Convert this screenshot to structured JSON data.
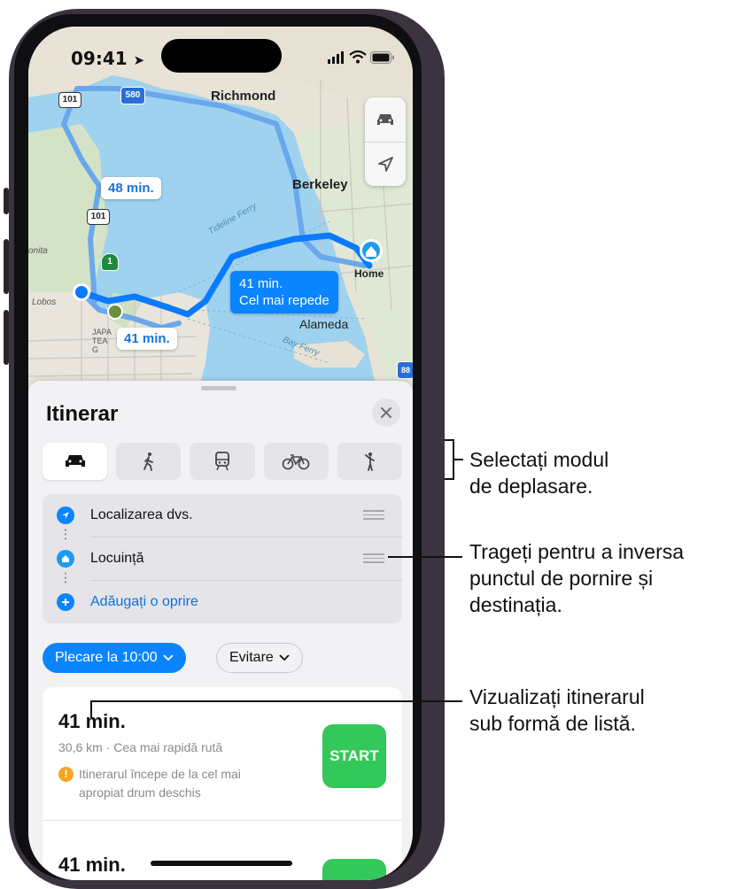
{
  "status_bar": {
    "time": "09:41"
  },
  "map": {
    "labels": {
      "richmond": "Richmond",
      "berkeley": "Berkeley",
      "alameda": "Alameda",
      "home": "Home",
      "lobos": "Lobos",
      "onita": "onita",
      "japan_tea": "JAPA TEA G"
    },
    "highway_shields": {
      "us101_top": "101",
      "us101_mid": "101",
      "i580": "580",
      "ca1": "1",
      "i880": "88"
    },
    "route_callouts": {
      "route1": "48 min.",
      "route2_time": "41 min.",
      "route2_label": "Cel mai repede",
      "route3": "41 min."
    },
    "ferry_labels": {
      "tideline": "Tideline Ferry",
      "bay": "Bay Ferry"
    }
  },
  "sheet": {
    "title": "Itinerar",
    "transport_modes": [
      "car-icon",
      "walk-icon",
      "transit-icon",
      "bicycle-icon",
      "rideshare-icon"
    ],
    "stops": [
      {
        "label": "Localizarea dvs."
      },
      {
        "label": "Locuință"
      },
      {
        "label": "Adăugați o oprire"
      }
    ],
    "depart_button": "Plecare la 10:00",
    "avoid_button": "Evitare",
    "routes": [
      {
        "time": "41 min.",
        "details": "30,6 km · Cea mai rapidă rută",
        "warning": "Itinerarul începe de la cel mai apropiat drum deschis",
        "start_label": "START"
      },
      {
        "time": "41 min."
      }
    ]
  },
  "annotations": {
    "mode": "Selectați modul\nde deplasare.",
    "drag": "Trageți pentru a inversa\npunctul de pornire și\ndestinația.",
    "list": "Vizualizați itinerarul\nsub formă de listă."
  },
  "colors": {
    "accent": "#0a84ff",
    "start": "#34c759",
    "warning": "#f5a623"
  }
}
